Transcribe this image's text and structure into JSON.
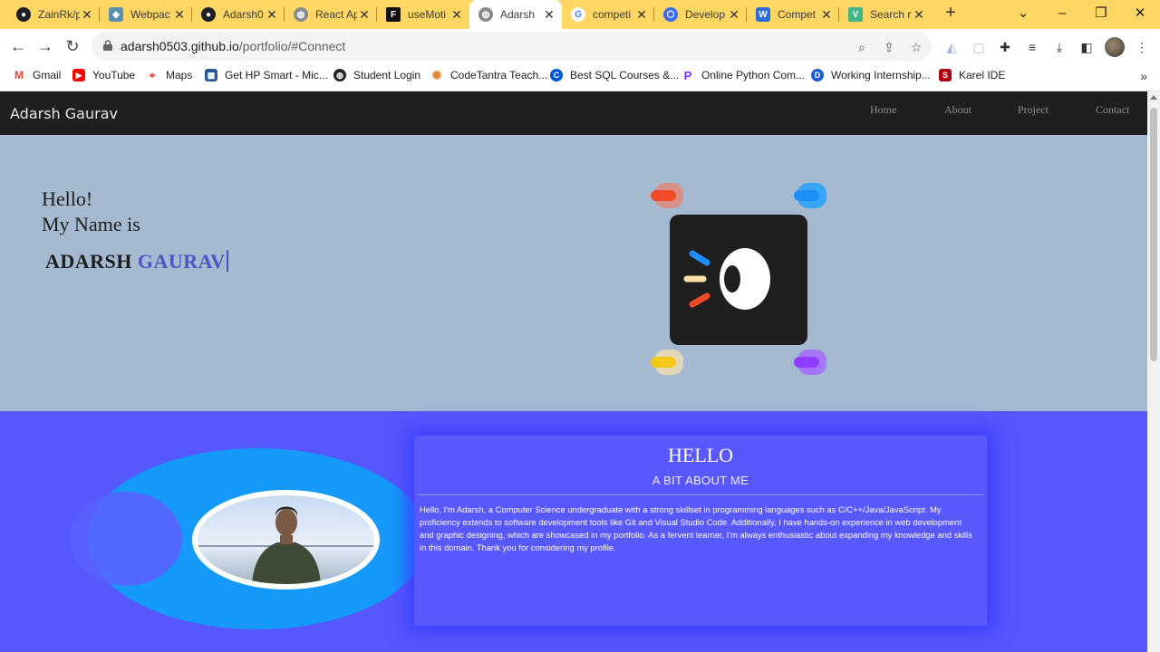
{
  "browser": {
    "tabs": [
      {
        "title": "ZainRk/p",
        "icon": "github-icon",
        "color": "#1b1f23"
      },
      {
        "title": "Webpac",
        "icon": "webpack-icon",
        "color": "#5a8fb0"
      },
      {
        "title": "Adarsh0",
        "icon": "github-icon",
        "color": "#1b1f23"
      },
      {
        "title": "React Ap",
        "icon": "globe-icon",
        "color": "#888888"
      },
      {
        "title": "useMoti",
        "icon": "framer-icon",
        "color": "#111111"
      },
      {
        "title": "Adarsh",
        "icon": "globe-icon",
        "color": "#888888",
        "active": true
      },
      {
        "title": "competi",
        "icon": "google-icon",
        "color": "#4285f4"
      },
      {
        "title": "Develop",
        "icon": "devpost-icon",
        "color": "#3c6df0"
      },
      {
        "title": "Compet",
        "icon": "wellfound-icon",
        "color": "#2b6cd8"
      },
      {
        "title": "Search r",
        "icon": "vue-icon",
        "color": "#41b883"
      }
    ],
    "url_host": "adarsh0503.github.io",
    "url_path": "/portfolio/#Connect",
    "bookmarks": [
      {
        "label": "Gmail",
        "icon": "gmail-icon",
        "color": "#ea4335"
      },
      {
        "label": "YouTube",
        "icon": "youtube-icon",
        "color": "#ff0000"
      },
      {
        "label": "Maps",
        "icon": "maps-icon",
        "color": "#34a853"
      },
      {
        "label": "Get HP Smart - Mic...",
        "icon": "microsoft-store-icon",
        "color": "#2b5797"
      },
      {
        "label": "Student Login",
        "icon": "globe-icon",
        "color": "#222222"
      },
      {
        "label": "CodeTantra Teach...",
        "icon": "codetantra-icon",
        "color": "#e0863a"
      },
      {
        "label": "Best SQL Courses &...",
        "icon": "coursera-icon",
        "color": "#0056d2"
      },
      {
        "label": "Online Python Com...",
        "icon": "programiz-icon",
        "color": "#7b2ff7"
      },
      {
        "label": "Working Internship...",
        "icon": "d-icon",
        "color": "#1e5bd6"
      },
      {
        "label": "Karel IDE",
        "icon": "stanford-icon",
        "color": "#b1040e"
      }
    ]
  },
  "site": {
    "brand": "Adarsh Gaurav",
    "nav": [
      "Home",
      "About",
      "Project",
      "Contact"
    ],
    "hero": {
      "greeting": "Hello!",
      "intro": "My Name is",
      "first_name": "ADARSH",
      "last_name": "GAURAV"
    },
    "about": {
      "title": "HELLO",
      "subtitle": "A BIT ABOUT ME",
      "body": "Hello, I'm Adarsh, a Computer Science undergraduate with a strong skillset in programming languages such as C/C++/Java/JavaScript. My proficiency extends to software development tools like Git and Visual Studio Code. Additionally, I have hands-on experience in web development and graphic designing, which are showcased in my portfolio. As a fervent learner, I'm always enthusiastic about expanding my knowledge and skills in this domain. Thank you for considering my profile."
    }
  }
}
